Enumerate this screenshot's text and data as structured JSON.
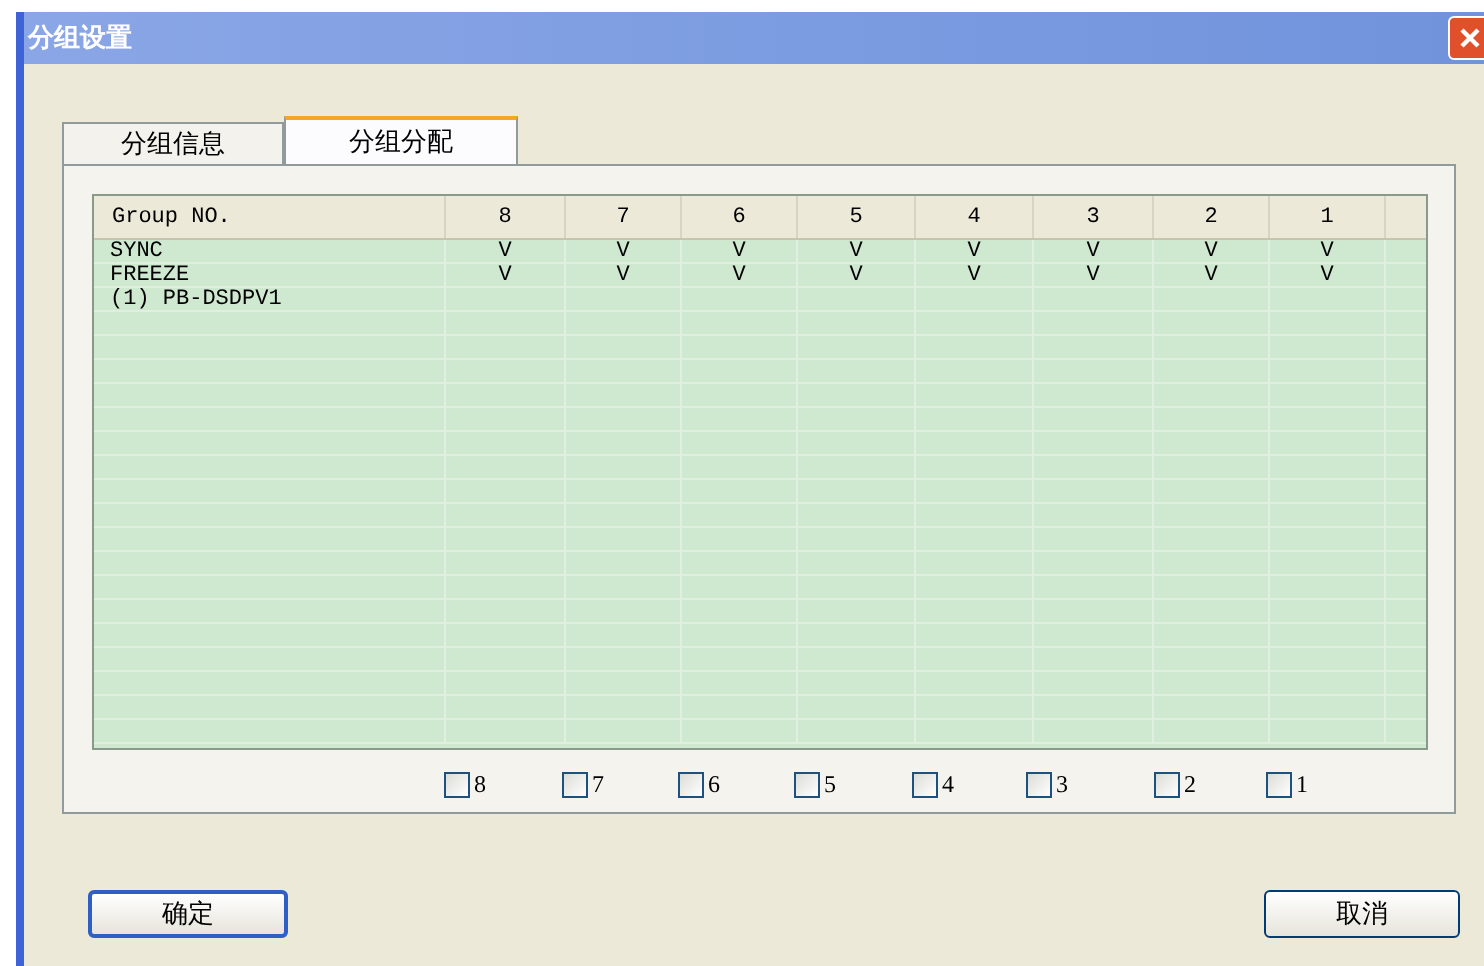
{
  "window": {
    "title": "分组设置"
  },
  "tabs": [
    {
      "label": "分组信息",
      "selected": false
    },
    {
      "label": "分组分配",
      "selected": true
    }
  ],
  "table": {
    "columns": [
      "Group NO.",
      "8",
      "7",
      "6",
      "5",
      "4",
      "3",
      "2",
      "1"
    ],
    "rows": [
      {
        "name": "SYNC",
        "cells": [
          "V",
          "V",
          "V",
          "V",
          "V",
          "V",
          "V",
          "V"
        ]
      },
      {
        "name": "FREEZE",
        "cells": [
          "V",
          "V",
          "V",
          "V",
          "V",
          "V",
          "V",
          "V"
        ]
      },
      {
        "name": "(1) PB-DSDPV1"
      }
    ]
  },
  "checkboxes": [
    {
      "label": "8",
      "checked": false
    },
    {
      "label": "7",
      "checked": false
    },
    {
      "label": "6",
      "checked": false
    },
    {
      "label": "5",
      "checked": false
    },
    {
      "label": "4",
      "checked": false
    },
    {
      "label": "3",
      "checked": false
    },
    {
      "label": "2",
      "checked": false
    },
    {
      "label": "1",
      "checked": false
    }
  ],
  "buttons": [
    "确定",
    "取消"
  ]
}
